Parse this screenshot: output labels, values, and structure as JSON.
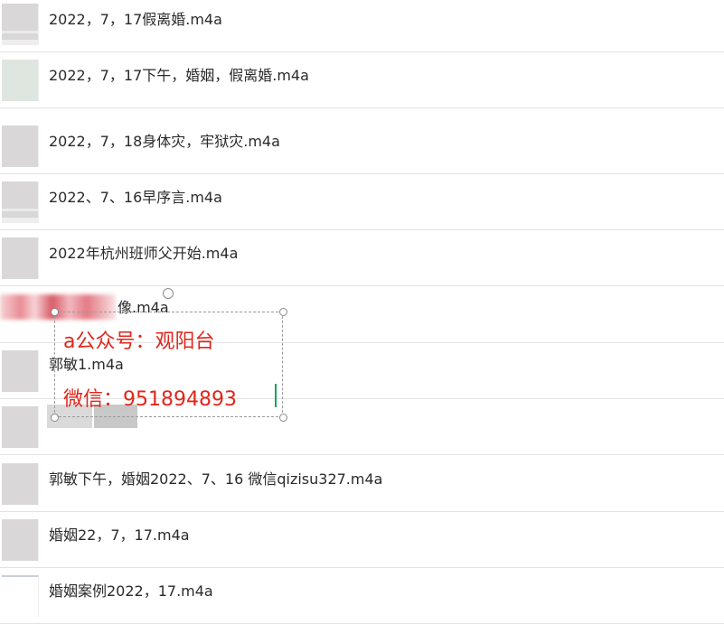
{
  "files": [
    {
      "name": "2022，7，17假离婚.m4a",
      "thumb": "striped"
    },
    {
      "name": "2022，7，17下午，婚姻，假离婚.m4a",
      "thumb": "greenish"
    },
    {
      "name": "2022，7，18身体灾，牢狱灾.m4a",
      "thumb": "plain"
    },
    {
      "name": "2022、7、16早序言.m4a",
      "thumb": "striped"
    },
    {
      "name": "2022年杭州班师父开始.m4a",
      "thumb": "plain"
    },
    {
      "name": "像.m4a",
      "thumb": "plain"
    },
    {
      "name": "郭敏1.m4a",
      "thumb": "plain"
    },
    {
      "name": "",
      "thumb": "plain"
    },
    {
      "name": "郭敏下午，婚姻2022、7、16 微信qizisu327.m4a",
      "thumb": "plain"
    },
    {
      "name": "婚姻22，7，17.m4a",
      "thumb": "plain"
    },
    {
      "name": "婚姻案例2022，17.m4a",
      "thumb": "lined"
    }
  ],
  "overlay": {
    "line1": "a公众号：观阳台",
    "line2": "微信：951894893"
  }
}
